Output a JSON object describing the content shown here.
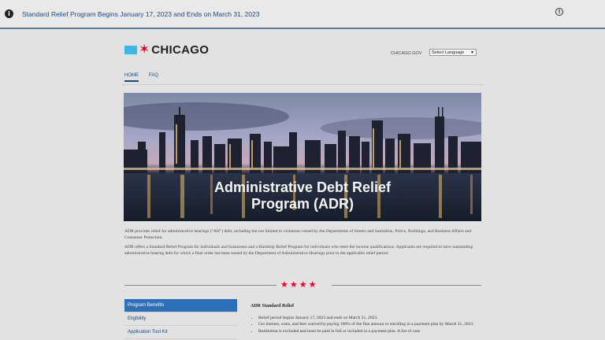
{
  "alert": {
    "icon": "info-icon",
    "message": "Standard Relief Program Begins January 17, 2023 and Ends on March 31, 2023",
    "close_icon": "close-icon"
  },
  "header": {
    "logo_text": "CHICAGO",
    "logo_star": "✶",
    "gov_link": "CHICAGO.GOV",
    "language_select": "Select Language"
  },
  "nav": {
    "items": [
      {
        "label": "HOME",
        "active": true
      },
      {
        "label": "FAQ",
        "active": false
      }
    ]
  },
  "hero": {
    "title_line1": "Administrative Debt Relief",
    "title_line2": "Program (ADR)"
  },
  "intro": {
    "paragraph1": "ADR provides relief for administrative hearings (\"AH\") debt, including but not limited to violations issued by the Departments of Streets and Sanitation, Police, Buildings, and Business Affairs and Consumer Protection.",
    "paragraph2": "ADR offers a Standard Relief Program for individuals and businesses and a Hardship Relief Program for individuals who meet the income qualifications. Applicants are required to have outstanding administrative hearing debt for which a final order has been issued by the Department of Administrative Hearings prior to the applicable relief period."
  },
  "divider": {
    "stars": "★★★★"
  },
  "sidenav": {
    "items": [
      {
        "label": "Program Benefits",
        "active": true
      },
      {
        "label": "Eligibility",
        "active": false
      },
      {
        "label": "Application Tool Kit",
        "active": false
      }
    ]
  },
  "content": {
    "heading": "ADR Standard Relief",
    "bullets": [
      "Relief period begins January 17, 2023 and ends on March 31, 2023.",
      "Get interest, costs, and fees waived by paying 100% of the fine amount or enrolling in a payment plan by March 31, 2023.",
      "Restitution is excluded and must be paid in full or included in a payment plan. A list of case"
    ]
  },
  "colors": {
    "accent_blue": "#2c70b9",
    "chicago_red": "#e4002b",
    "chicago_light_blue": "#41b6e6",
    "link_blue": "#1f4a7a"
  }
}
